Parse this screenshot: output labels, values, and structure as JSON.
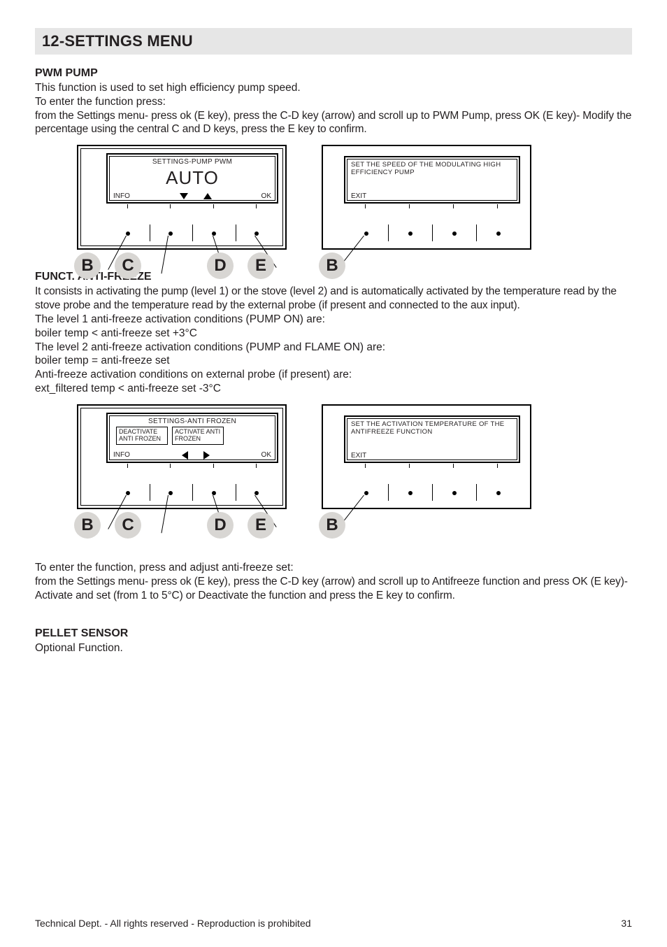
{
  "title": "12-SETTINGS MENU",
  "pwm": {
    "head": "PWM PUMP",
    "p1": "This function is used to set high efficiency pump speed.",
    "p2": "To enter the function press:",
    "p3": "from the Settings menu- press ok (E key), press the C-D key (arrow) and scroll up to PWM Pump, press OK (E key)- Modify the percentage using the central C and D keys, press the E key to confirm.",
    "screen_title": "SETTINGS-PUMP PWM",
    "screen_big": "AUTO",
    "info_label": "INFO",
    "ok_label": "OK",
    "right_msg": "SET THE SPEED OF THE MODULATING HIGH EFFICIENCY PUMP",
    "exit": "EXIT"
  },
  "af": {
    "head": "FUNCT. ANTI-FREEZE",
    "p1": "It consists in activating the pump (level 1) or the stove (level 2) and is automatically activated by the temperature read by the stove probe and the temperature read by the external probe (if present and connected to the aux input).",
    "p2": "The level 1 anti-freeze activation conditions (PUMP ON) are:",
    "p3": "boiler temp < anti-freeze set +3°C",
    "p4": "The level 2 anti-freeze activation conditions (PUMP and FLAME ON) are:",
    "p5": "boiler temp = anti-freeze set",
    "p6": "Anti-freeze activation conditions on external probe (if present) are:",
    "p7": "ext_filtered temp < anti-freeze set -3°C",
    "screen_title": "SETTINGS-ANTI FROZEN",
    "box_left": "DEACTIVATE ANTI FROZEN",
    "box_right": "ACTIVATE ANTI FROZEN",
    "info_label": "INFO",
    "ok_label": "OK",
    "right_msg": "SET THE ACTIVATION TEMPERATURE OF THE ANTIFREEZE FUNCTION",
    "exit": "EXIT",
    "post1": "To enter the function, press and adjust anti-freeze set:",
    "post2": "from the Settings menu- press ok (E key), press the C-D key (arrow) and scroll up to Antifreeze function and press OK (E key)- Activate and set (from 1 to 5°C) or Deactivate the function and press the E key to confirm."
  },
  "pellet": {
    "head": "PELLET SENSOR",
    "p1": "Optional Function."
  },
  "letters": {
    "B": "B",
    "C": "C",
    "D": "D",
    "E": "E"
  },
  "footer": {
    "left": "Technical Dept. - All rights reserved - Reproduction is prohibited",
    "right": "31"
  }
}
